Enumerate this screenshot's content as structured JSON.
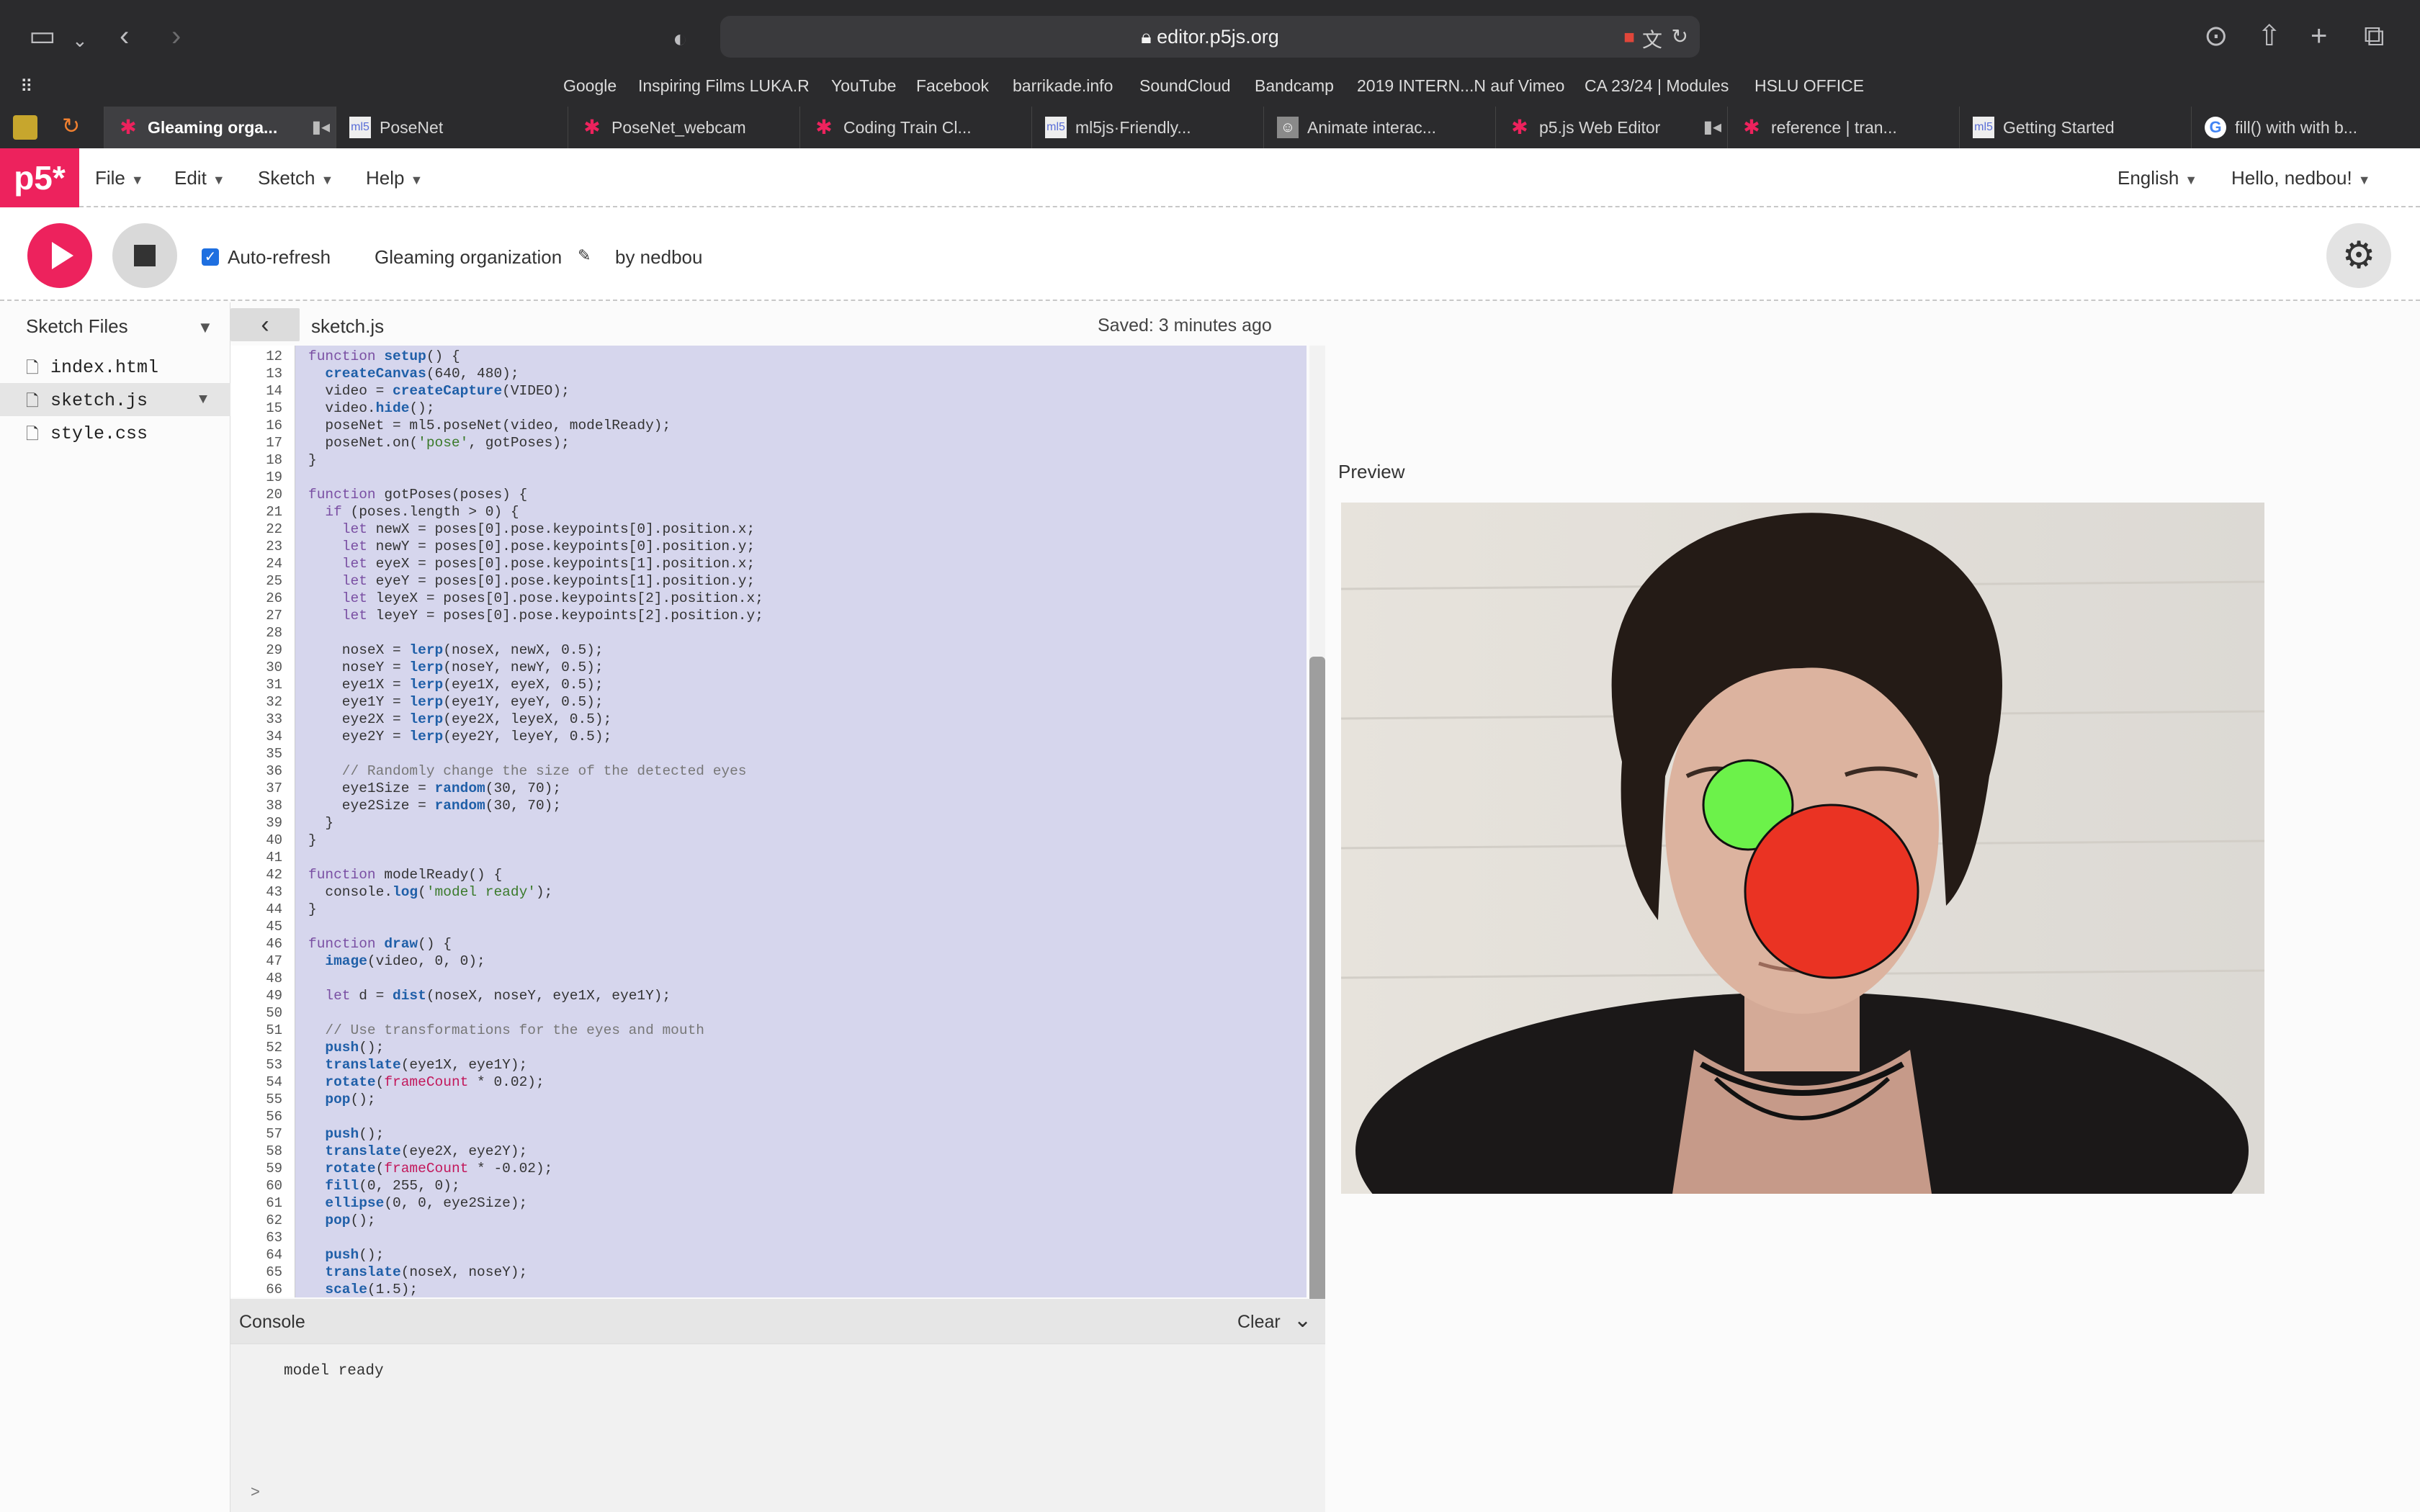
{
  "browser": {
    "url": "editor.p5js.org",
    "bookmarks": [
      "Google",
      "Inspiring Films LUKA.R",
      "YouTube",
      "Facebook",
      "barrikade.info",
      "SoundCloud",
      "Bandcamp",
      "2019 INTERN...N auf Vimeo",
      "CA 23/24 | Modules",
      "HSLU OFFICE"
    ],
    "tabs": [
      {
        "label": "Gleaming orga...",
        "icon": "p5-asterisk-icon"
      },
      {
        "label": "PoseNet",
        "icon": "ml5-icon"
      },
      {
        "label": "PoseNet_webcam",
        "icon": "p5-asterisk-icon"
      },
      {
        "label": "Coding Train Cl...",
        "icon": "p5-asterisk-icon"
      },
      {
        "label": "ml5js·Friendly...",
        "icon": "ml5-icon"
      },
      {
        "label": "Animate interac...",
        "icon": "avatar-icon"
      },
      {
        "label": "p5.js Web Editor",
        "icon": "p5-asterisk-icon"
      },
      {
        "label": "reference | tran...",
        "icon": "p5-asterisk-icon"
      },
      {
        "label": "Getting Started",
        "icon": "ml5-icon"
      },
      {
        "label": "fill() with with b...",
        "icon": "google-icon"
      }
    ]
  },
  "app": {
    "logo": "p5*",
    "menu": [
      "File",
      "Edit",
      "Sketch",
      "Help"
    ],
    "language": "English",
    "user": "Hello, nedbou!",
    "auto_refresh": "Auto-refresh",
    "sketch_name": "Gleaming organization",
    "author": "by nedbou"
  },
  "sidebar": {
    "title": "Sketch Files",
    "files": [
      "index.html",
      "sketch.js",
      "style.css"
    ],
    "selected": "sketch.js"
  },
  "editor": {
    "filename": "sketch.js",
    "saved": "Saved: 3 minutes ago",
    "first_line": 12,
    "lines": [
      "function setup() {",
      "  createCanvas(640, 480);",
      "  video = createCapture(VIDEO);",
      "  video.hide();",
      "  poseNet = ml5.poseNet(video, modelReady);",
      "  poseNet.on('pose', gotPoses);",
      "}",
      "",
      "function gotPoses(poses) {",
      "  if (poses.length > 0) {",
      "    let newX = poses[0].pose.keypoints[0].position.x;",
      "    let newY = poses[0].pose.keypoints[0].position.y;",
      "    let eyeX = poses[0].pose.keypoints[1].position.x;",
      "    let eyeY = poses[0].pose.keypoints[1].position.y;",
      "    let leyeX = poses[0].pose.keypoints[2].position.x;",
      "    let leyeY = poses[0].pose.keypoints[2].position.y;",
      "",
      "    noseX = lerp(noseX, newX, 0.5);",
      "    noseY = lerp(noseY, newY, 0.5);",
      "    eye1X = lerp(eye1X, eyeX, 0.5);",
      "    eye1Y = lerp(eye1Y, eyeY, 0.5);",
      "    eye2X = lerp(eye2X, leyeX, 0.5);",
      "    eye2Y = lerp(eye2Y, leyeY, 0.5);",
      "",
      "    // Randomly change the size of the detected eyes",
      "    eye1Size = random(30, 70);",
      "    eye2Size = random(30, 70);",
      "  }",
      "}",
      "",
      "function modelReady() {",
      "  console.log('model ready');",
      "}",
      "",
      "function draw() {",
      "  image(video, 0, 0);",
      "",
      "  let d = dist(noseX, noseY, eye1X, eye1Y);",
      "",
      "  // Use transformations for the eyes and mouth",
      "  push();",
      "  translate(eye1X, eye1Y);",
      "  rotate(frameCount * 0.02);",
      "  pop();",
      "",
      "  push();",
      "  translate(eye2X, eye2Y);",
      "  rotate(frameCount * -0.02);",
      "  fill(0, 255, 0);",
      "  ellipse(0, 0, eye2Size);",
      "  pop();",
      "",
      "  push();",
      "  translate(noseX, noseY);",
      "  scale(1.5);"
    ]
  },
  "console": {
    "title": "Console",
    "clear": "Clear",
    "messages": [
      "model ready"
    ],
    "prompt": ">"
  },
  "preview": {
    "title": "Preview",
    "eye_circle_color": "#6cf24a",
    "nose_circle_color": "#ea3323"
  }
}
